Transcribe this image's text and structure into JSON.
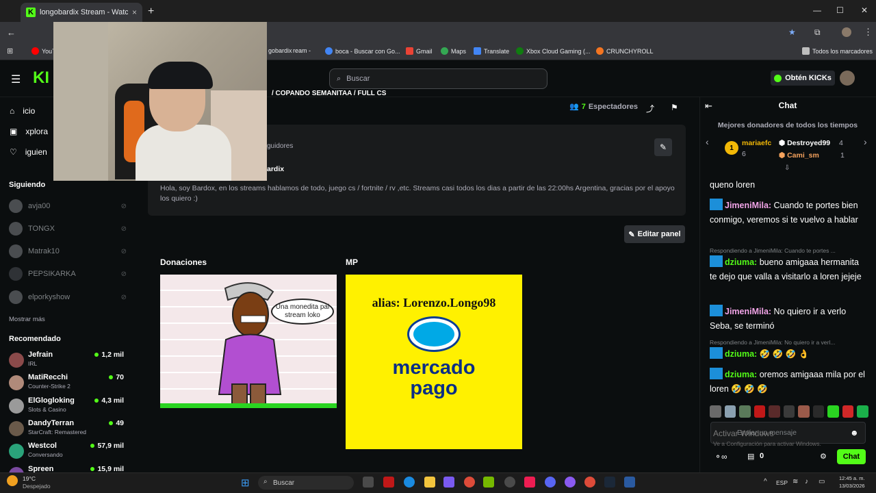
{
  "browser": {
    "tab_title": "longobardix Stream - Watch Live o",
    "tab_close": "×",
    "new_tab": "+",
    "bookmarks": [
      {
        "label": "YouTube",
        "color": "#ff0000"
      },
      {
        "label": "gobardix",
        "color": "#53fc18"
      },
      {
        "label": "ream -",
        "color": "#53fc18"
      },
      {
        "label": "boca - Buscar con Go...",
        "color": "#4285f4"
      },
      {
        "label": "Gmail",
        "color": "#ea4335"
      },
      {
        "label": "Maps",
        "color": "#34a853"
      },
      {
        "label": "Translate",
        "color": "#4285f4"
      },
      {
        "label": "Xbox Cloud Gaming (...",
        "color": "#107c10"
      },
      {
        "label": "CRUNCHYROLL",
        "color": "#f47521"
      }
    ],
    "all_bookmarks": "Todos los marcadores"
  },
  "header": {
    "search_placeholder": "Buscar",
    "get_kicks": "Obtén KICKs"
  },
  "sidebar": {
    "nav": [
      {
        "label": "icio"
      },
      {
        "label": "xplora"
      },
      {
        "label": "iguien"
      }
    ],
    "following_title": "Siguiendo",
    "following": [
      {
        "name": "avja00"
      },
      {
        "name": "TONGX"
      },
      {
        "name": "Matrak10"
      },
      {
        "name": "PEPSIKARKA"
      },
      {
        "name": "elporkyshow"
      }
    ],
    "show_more": "Mostrar más",
    "recommended_title": "Recomendado",
    "recommended": [
      {
        "name": "Jefrain",
        "category": "IRL",
        "viewers": "1,2 mil",
        "color": "#8a4a4a"
      },
      {
        "name": "MatiRecchi",
        "category": "Counter-Strike 2",
        "viewers": "70",
        "color": "#b08a7a"
      },
      {
        "name": "ElGlogloking",
        "category": "Slots & Casino",
        "viewers": "4,3 mil",
        "color": "#9a9a9a"
      },
      {
        "name": "DandyTerran",
        "category": "StarCraft: Remastered",
        "viewers": "49",
        "color": "#6a5a4a"
      },
      {
        "name": "Westcol",
        "category": "Conversando",
        "viewers": "57,9 mil",
        "color": "#2aa37a"
      },
      {
        "name": "Spreen",
        "category": "",
        "viewers": "15,9 mil",
        "color": "#7a4aa0"
      }
    ]
  },
  "stream": {
    "title_fragment": "/ COPANDO SEMANITAA / FULL CS",
    "viewers_count": "7",
    "viewers_label": "Espectadores",
    "followers_fragment": "guidores",
    "username_fragment": "ardix",
    "about": "Hola, soy Bardox, en los streams hablamos de todo, juego cs / fortnite / rv ,etc. Streams casi todos los dias a partir de las 22:00hs Argentina, gracias por el apoyo los quiero :)",
    "edit_panel": "Editar panel"
  },
  "panels": [
    {
      "title": "Donaciones",
      "bubble": "Una monedita pal stream loko"
    },
    {
      "title": "MP",
      "alias": "alias: Lorenzo.Longo98",
      "brand_line1": "mercado",
      "brand_line2": "pago"
    }
  ],
  "chat": {
    "title": "Chat",
    "donors_title": "Mejores donadores de todos los tiempos",
    "donors": [
      {
        "rank": "1",
        "name": "mariaefc",
        "amount": "6",
        "color": "#f2b807"
      },
      {
        "name": "Destroyed99",
        "amount": "4",
        "color": "#ffffff"
      },
      {
        "name": "Cami_sm",
        "amount": "1",
        "color": "#f5a25d"
      }
    ],
    "messages": [
      {
        "type": "tail",
        "text": "queno loren"
      },
      {
        "type": "msg",
        "user": "JimeniMila:",
        "color": "#f0a3e6",
        "text": " Cuando te portes bien conmigo, veremos si te vuelvo a hablar"
      },
      {
        "type": "reply",
        "text": "Respondiendo a JimeniMila: Cuando te portes ..."
      },
      {
        "type": "msg",
        "user": "dziuma:",
        "color": "#53fc18",
        "text": " bueno amigaaa hermanita te dejo que valla a visitarlo a loren jejeje"
      },
      {
        "type": "msg",
        "user": "JimeniMila:",
        "color": "#f0a3e6",
        "text": " No quiero ir a verlo Seba, se terminó"
      },
      {
        "type": "reply",
        "text": "Respondiendo a JimeniMila: No quiero ir a verl..."
      },
      {
        "type": "msg",
        "user": "dziuma:",
        "color": "#53fc18",
        "text": " 🤣 🤣 🤣 👌"
      },
      {
        "type": "msg",
        "user": "dziuma:",
        "color": "#53fc18",
        "text": " oremos amigaaa mila por el loren 🤣 🤣 🤣"
      }
    ],
    "input_placeholder": "Enviar un mensaje",
    "points": "0",
    "send": "Chat",
    "watermark_line1": "Activar Windows",
    "watermark_line2": "Ve a Configuración para activar Windows."
  },
  "taskbar": {
    "weather_temp": "19°C",
    "weather_desc": "Despejado",
    "search": "Buscar",
    "lang": "ESP",
    "time": "12:45 a. m.",
    "date": "13/03/2026"
  }
}
